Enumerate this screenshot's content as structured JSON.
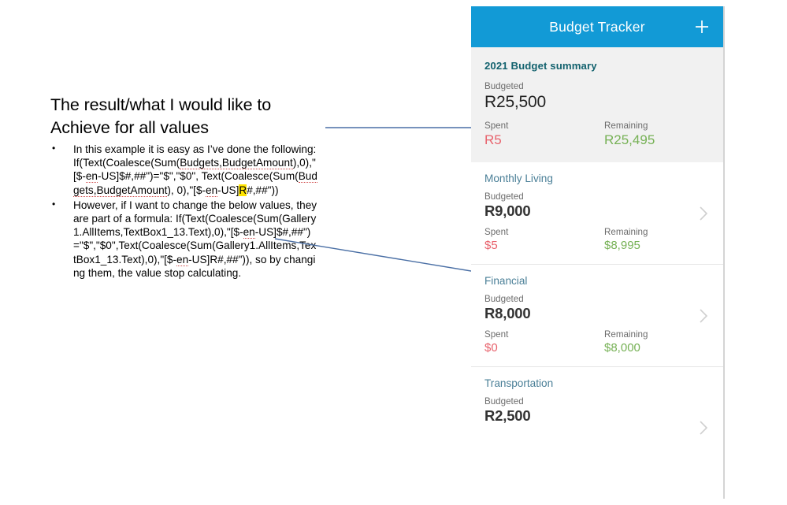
{
  "slide": {
    "heading": "The result/what I would like to Achieve for all values",
    "bullets": [
      {
        "intro": "In this example it is easy as I’ve done the following:",
        "formula_parts": [
          {
            "t": "If(Text(Coalesce(Sum(",
            "style": "plain"
          },
          {
            "t": "Budgets,BudgetAmount",
            "style": "spellerror"
          },
          {
            "t": "),0),\"[$-",
            "style": "plain"
          },
          {
            "t": "en",
            "style": "spellerror"
          },
          {
            "t": "-US]$#,##\")=\"$\",\"$0\", Text(Coalesce(Sum(",
            "style": "plain"
          },
          {
            "t": "Budgets,BudgetAmount",
            "style": "spellerror"
          },
          {
            "t": "), 0),\"[$-",
            "style": "plain"
          },
          {
            "t": "en",
            "style": "spellerror"
          },
          {
            "t": "-US]",
            "style": "plain"
          },
          {
            "t": "R",
            "style": "highlight"
          },
          {
            "t": "#,##\"))",
            "style": "plain"
          }
        ],
        "formula_plain": "If(Text(Coalesce(Sum(Budgets,BudgetAmount),0),\"[$-en-US]$#,##\")=\"$\",\"$0\", Text(Coalesce(Sum(Budgets,BudgetAmount), 0),\"[$-en-US]R#,##\"))"
      },
      {
        "intro": "However, if I want to change the below values, they are part of a formula:",
        "formula_parts": [
          {
            "t": "If(Text(Coalesce(Sum(Gallery1.AllItems,TextBox1_13.Text),0),\"[$-",
            "style": "plain"
          },
          {
            "t": "en",
            "style": "spellerror"
          },
          {
            "t": "-US]$#,##\")=\"$\",\"$0\",Text(Coalesce(Sum(Gallery1.AllItems,TextBox1_13.Text),0),\"[$-",
            "style": "plain"
          },
          {
            "t": "en",
            "style": "spellerror"
          },
          {
            "t": "-US]R#,##\")), so by changing them, the value stop calculating.",
            "style": "plain"
          }
        ],
        "formula_plain": "If(Text(Coalesce(Sum(Gallery1.AllItems,TextBox1_13.Text),0),\"[$-en-US]$#,##\")=\"$\",\"$0\",Text(Coalesce(Sum(Gallery1.AllItems,TextBox1_13.Text),0),\"[$-en-US]R#,##\")), so by changing them, the value stop calculating."
      }
    ]
  },
  "app": {
    "header": {
      "title": "Budget Tracker",
      "add_icon": "plus-icon",
      "background_color": "#129ad6",
      "title_color": "#ffffff"
    },
    "summary": {
      "title": "2021 Budget summary",
      "budgeted_label": "Budgeted",
      "budgeted_value": "R25,500",
      "spent_label": "Spent",
      "spent_value": "R5",
      "remaining_label": "Remaining",
      "remaining_value": "R25,495",
      "background_color": "#f1f1f1",
      "title_color": "#13626e"
    },
    "labels": {
      "budgeted": "Budgeted",
      "spent": "Spent",
      "remaining": "Remaining"
    },
    "colors": {
      "spent": "#e8626c",
      "remaining": "#76b155",
      "category_title": "#4a7f97",
      "accent": "#129ad6"
    },
    "categories": [
      {
        "name": "Monthly Living",
        "budgeted_label": "Budgeted",
        "budgeted_value": "R9,000",
        "spent_label": "Spent",
        "spent_value": "$5",
        "remaining_label": "Remaining",
        "remaining_value": "$8,995",
        "chevron": "chevron-right-icon"
      },
      {
        "name": "Financial",
        "budgeted_label": "Budgeted",
        "budgeted_value": "R8,000",
        "spent_label": "Spent",
        "spent_value": "$0",
        "remaining_label": "Remaining",
        "remaining_value": "$8,000",
        "chevron": "chevron-right-icon"
      },
      {
        "name": "Transportation",
        "budgeted_label": "Budgeted",
        "budgeted_value": "R2,500",
        "spent_label": "",
        "spent_value": "",
        "remaining_label": "",
        "remaining_value": "",
        "chevron": "chevron-right-icon"
      }
    ]
  },
  "annotations": {
    "circle_target": "R",
    "arrow_1": "points to R in R25,500",
    "arrow_2": "points to $5 spent in Monthly Living"
  }
}
